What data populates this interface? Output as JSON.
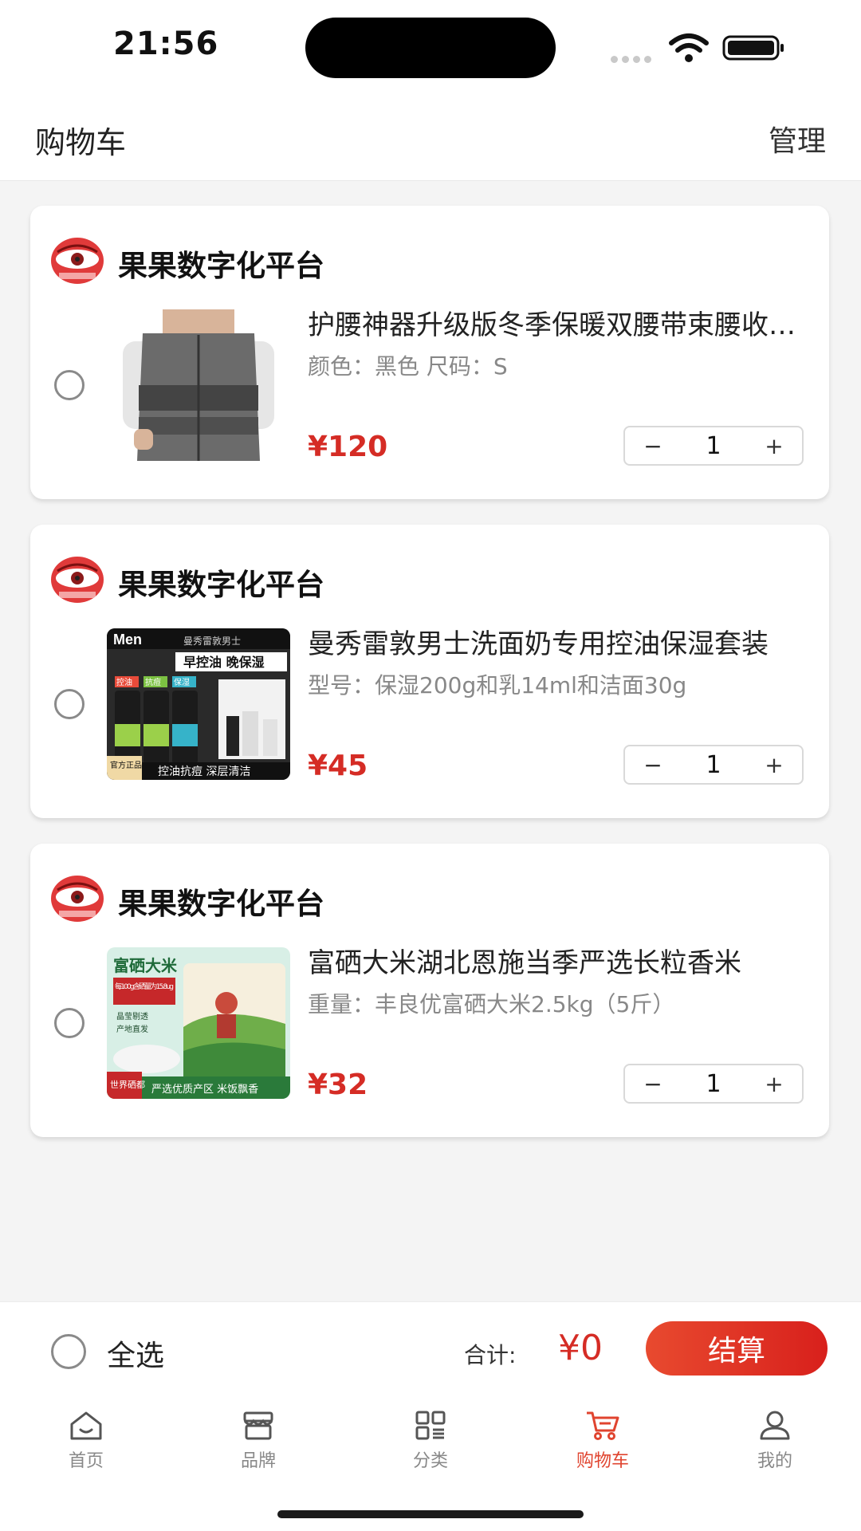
{
  "status_bar": {
    "time": "21:56"
  },
  "header": {
    "title": "购物车",
    "manage_label": "管理"
  },
  "cart": {
    "items": [
      {
        "store_name": "果果数字化平台",
        "title": "护腰神器升级版冬季保暖双腰带束腰收腹带",
        "spec": "颜色：黑色 尺码：S",
        "price": "¥120",
        "quantity": "1"
      },
      {
        "store_name": "果果数字化平台",
        "title": "曼秀雷敦男士洗面奶专用控油保湿套装",
        "spec": "型号：保湿200g和乳14ml和洁面30g",
        "price": "¥45",
        "quantity": "1",
        "image_text": {
          "brand": "Men",
          "subtitle": "曼秀雷敦男士",
          "headline": "早控油 晚保湿",
          "tags": [
            "控油",
            "抗痘",
            "保湿"
          ],
          "badge": "官方正品",
          "bottom": "控油抗痘 深层清洁"
        }
      },
      {
        "store_name": "果果数字化平台",
        "title": "富硒大米湖北恩施当季严选长粒香米",
        "spec": "重量：丰良优富硒大米2.5kg（5斤）",
        "price": "¥32",
        "quantity": "1",
        "image_text": {
          "title": "富硒大米",
          "box": "每100g含硒量为15.8ug",
          "points": [
            "晶莹剔透",
            "产地直发"
          ],
          "badge": "世界硒都",
          "bottom": "严选优质产区 米饭飘香"
        }
      }
    ],
    "minus_symbol": "−",
    "plus_symbol": "+"
  },
  "checkout": {
    "select_all_label": "全选",
    "total_label": "合计:",
    "total_value": "¥0",
    "checkout_label": "结算"
  },
  "tabs": [
    {
      "label": "首页",
      "icon": "home-icon"
    },
    {
      "label": "品牌",
      "icon": "store-icon"
    },
    {
      "label": "分类",
      "icon": "category-icon"
    },
    {
      "label": "购物车",
      "icon": "cart-icon",
      "active": true
    },
    {
      "label": "我的",
      "icon": "profile-icon"
    }
  ],
  "colors": {
    "accent": "#d52c25",
    "tab_active": "#e0442f"
  }
}
